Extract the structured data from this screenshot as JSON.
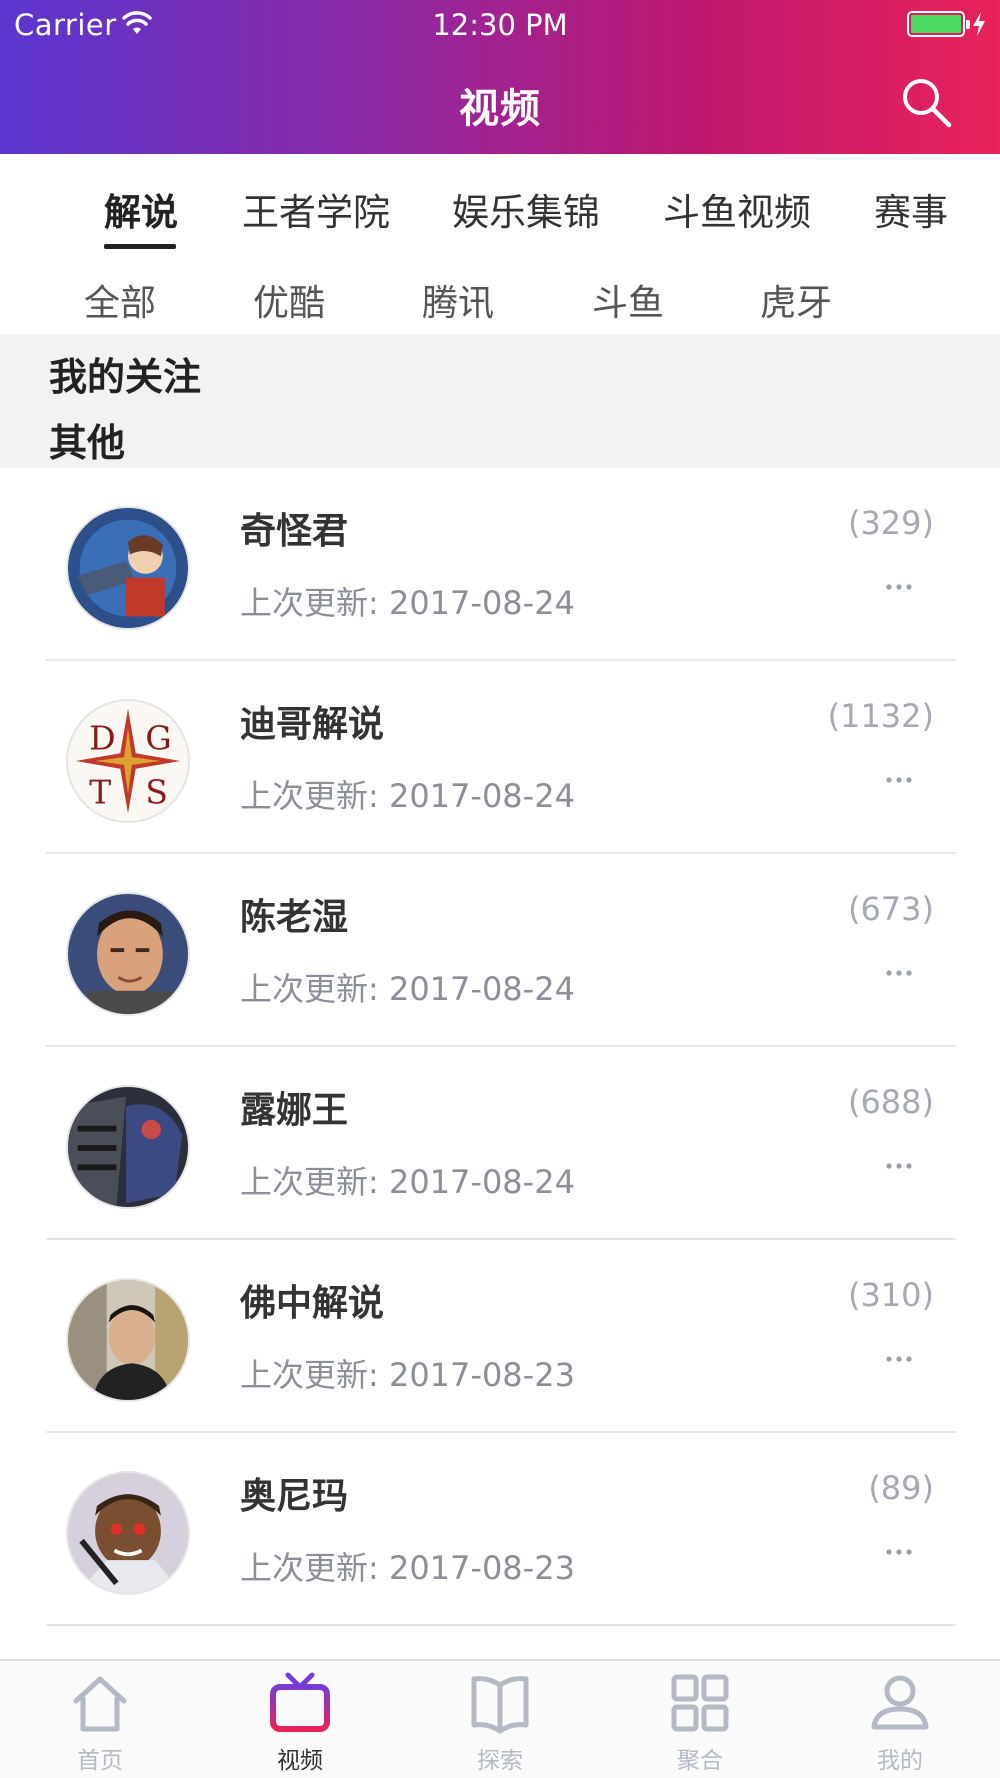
{
  "status_bar": {
    "carrier": "Carrier",
    "time": "12:30 PM"
  },
  "nav": {
    "title": "视频"
  },
  "tabs": [
    {
      "label": "解说",
      "active": true
    },
    {
      "label": "王者学院",
      "active": false
    },
    {
      "label": "娱乐集锦",
      "active": false
    },
    {
      "label": "斗鱼视频",
      "active": false
    },
    {
      "label": "赛事",
      "active": false
    }
  ],
  "subtabs": [
    {
      "label": "全部"
    },
    {
      "label": "优酷"
    },
    {
      "label": "腾讯"
    },
    {
      "label": "斗鱼"
    },
    {
      "label": "虎牙"
    }
  ],
  "sections": {
    "following": "我的关注",
    "other": "其他"
  },
  "list": [
    {
      "name": "奇怪君",
      "count": "(329)",
      "updated": "上次更新: 2017-08-24"
    },
    {
      "name": "迪哥解说",
      "count": "(1132)",
      "updated": "上次更新: 2017-08-24"
    },
    {
      "name": "陈老湿",
      "count": "(673)",
      "updated": "上次更新: 2017-08-24"
    },
    {
      "name": "露娜王",
      "count": "(688)",
      "updated": "上次更新: 2017-08-24"
    },
    {
      "name": "佛中解说",
      "count": "(310)",
      "updated": "上次更新: 2017-08-23"
    },
    {
      "name": "奥尼玛",
      "count": "(89)",
      "updated": "上次更新: 2017-08-23"
    }
  ],
  "tabbar": [
    {
      "label": "首页",
      "icon": "home-icon",
      "active": false
    },
    {
      "label": "视频",
      "icon": "tv-icon",
      "active": true
    },
    {
      "label": "探索",
      "icon": "book-icon",
      "active": false
    },
    {
      "label": "聚合",
      "icon": "grid-icon",
      "active": false
    },
    {
      "label": "我的",
      "icon": "user-icon",
      "active": false
    }
  ],
  "colors": {
    "header_gradient_start": "#5a36cf",
    "header_gradient_end": "#e8225a",
    "active_tab_icon_top": "#7a3ad6",
    "active_tab_icon_bottom": "#e8225a",
    "inactive_icon": "#b3bac6",
    "battery": "#4cd964"
  }
}
